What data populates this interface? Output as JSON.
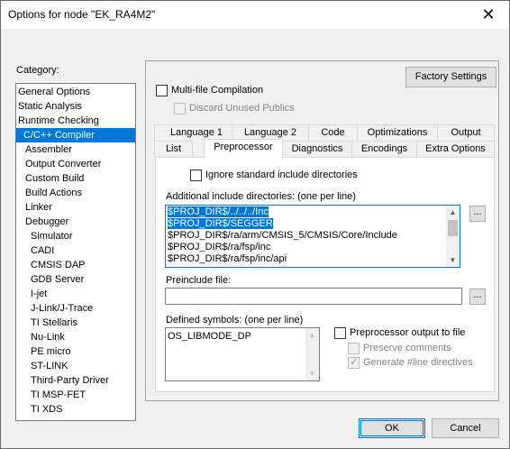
{
  "window": {
    "title": "Options for node \"EK_RA4M2\""
  },
  "category": {
    "label": "Category:",
    "items": [
      "General Options",
      "Static Analysis",
      "Runtime Checking",
      "C/C++ Compiler",
      "Assembler",
      "Output Converter",
      "Custom Build",
      "Build Actions",
      "Linker",
      "Debugger",
      "Simulator",
      "CADI",
      "CMSIS DAP",
      "GDB Server",
      "I-jet",
      "J-Link/J-Trace",
      "TI Stellaris",
      "Nu-Link",
      "PE micro",
      "ST-LINK",
      "Third-Party Driver",
      "TI MSP-FET",
      "TI XDS"
    ],
    "selected": "C/C++ Compiler"
  },
  "factory_settings": "Factory Settings",
  "multifile": {
    "label": "Multi-file Compilation",
    "checked": false
  },
  "discard": {
    "label": "Discard Unused Publics",
    "checked": false
  },
  "tabs_row1": [
    "Language 1",
    "Language 2",
    "Code",
    "Optimizations",
    "Output"
  ],
  "tabs_row2": [
    "List",
    "Preprocessor",
    "Diagnostics",
    "Encodings",
    "Extra Options"
  ],
  "active_tab": "Preprocessor",
  "ignore_std": {
    "label": "Ignore standard include directories",
    "checked": false
  },
  "include_dirs": {
    "label": "Additional include directories: (one per line)",
    "lines": [
      "$PROJ_DIR$/../../../Inc",
      "$PROJ_DIR$/SEGGER",
      "$PROJ_DIR$/ra/arm/CMSIS_5/CMSIS/Core/Include",
      "$PROJ_DIR$/ra/fsp/inc",
      "$PROJ_DIR$/ra/fsp/inc/api"
    ],
    "selected_lines": 2,
    "browse": "..."
  },
  "preinclude": {
    "label": "Preinclude file:",
    "value": "",
    "browse": "..."
  },
  "defined": {
    "label": "Defined symbols: (one per line)",
    "lines": [
      "OS_LIBMODE_DP"
    ]
  },
  "pp_output": {
    "label": "Preprocessor output to file",
    "checked": false
  },
  "preserve": {
    "label": "Preserve comments",
    "checked": false
  },
  "generate": {
    "label": "Generate #line directives",
    "checked": true
  },
  "ok": "OK",
  "cancel": "Cancel"
}
